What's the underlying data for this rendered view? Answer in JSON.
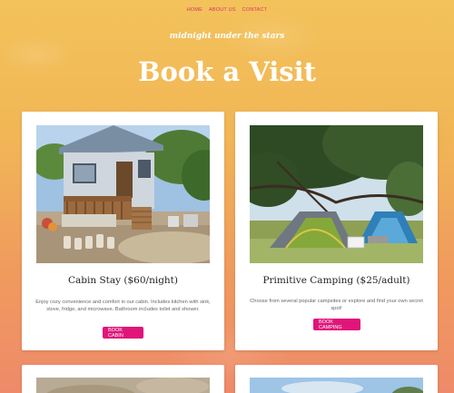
{
  "nav": {
    "items": [
      "HOME",
      "ABOUT US",
      "CONTACT"
    ]
  },
  "header": {
    "tagline": "midnight under the stars",
    "title": "Book a Visit"
  },
  "cards": [
    {
      "title": "Cabin Stay ($60/night)",
      "description": "Enjoy cozy convenience and comfort in our cabin. Includes kitchen with sink, stove, fridge, and microwave. Bathroom includes toilet and shower.",
      "button": "BOOK CABIN"
    },
    {
      "title": "Primitive Camping ($25/adult)",
      "description": "Choose from several popular campsites or explore and find your own secret spot!",
      "button": "BOOK CAMPING"
    }
  ],
  "colors": {
    "accent": "#e0157a",
    "nav_link": "#d6336c"
  }
}
